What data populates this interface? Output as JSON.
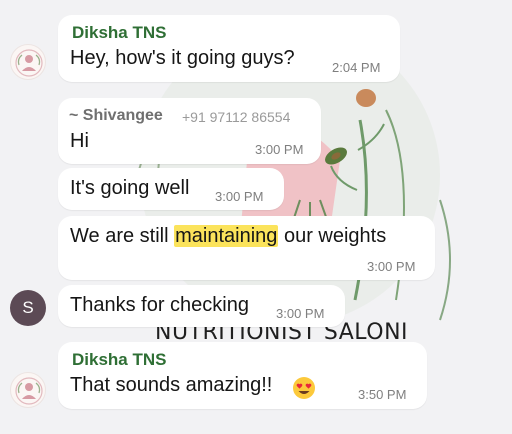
{
  "watermark": "NUTRITIONIST SALONI",
  "messages": [
    {
      "sender": "Diksha TNS",
      "text": "Hey, how's it going guys?",
      "time": "2:04 PM"
    },
    {
      "sender": "~ Shivangee",
      "sender_phone": "+91 97112 86554",
      "text": "Hi",
      "time": "3:00 PM"
    },
    {
      "text": "It's going well",
      "time": "3:00 PM"
    },
    {
      "text_before": "We are still ",
      "highlight": "maintaining",
      "text_after": " our weights",
      "time": "3:00 PM"
    },
    {
      "avatar_letter": "S",
      "text": "Thanks for checking",
      "time": "3:00 PM"
    },
    {
      "sender": "Diksha TNS",
      "text": "That sounds amazing!!",
      "emoji": "heart-eyes-emoji",
      "time": "3:50 PM"
    }
  ],
  "colors": {
    "sender_name": "#2f6f35",
    "highlight": "#fbe35b",
    "avatar_s": "#5c4a55"
  }
}
